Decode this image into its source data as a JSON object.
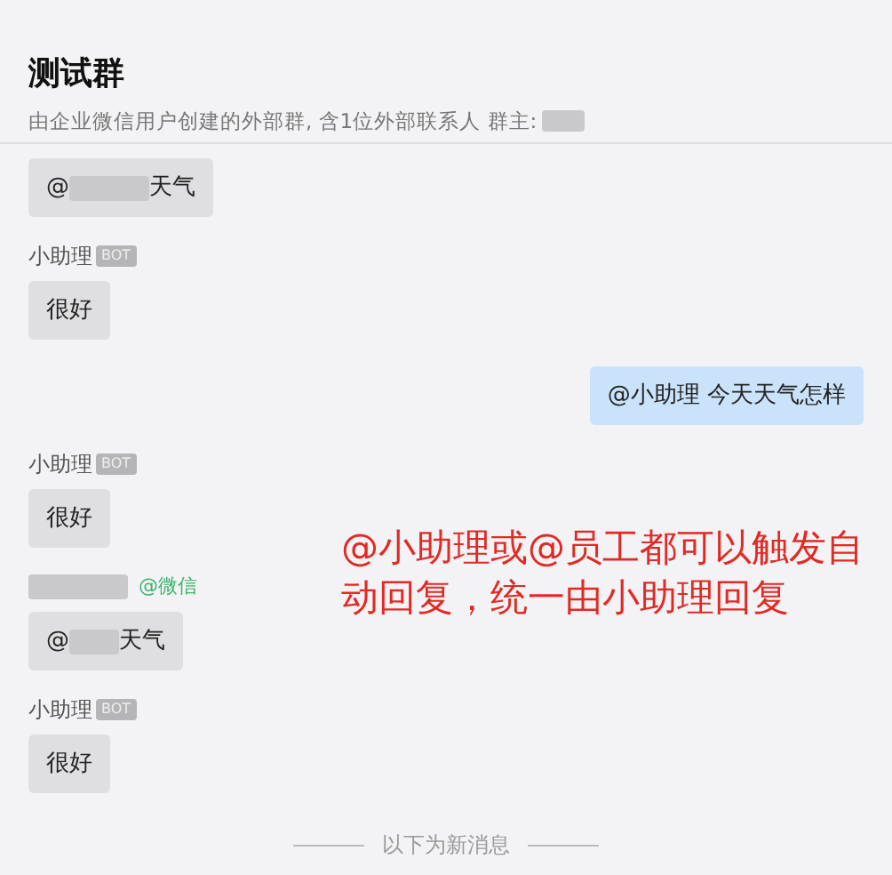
{
  "header": {
    "title": "测试群",
    "subtitle": "由企业微信用户创建的外部群, 含1位外部联系人 群主:",
    "subtitle_redacted": true
  },
  "messages": [
    {
      "kind": "incoming",
      "parts": [
        {
          "kind": "text",
          "text": "@"
        },
        {
          "kind": "redacted"
        },
        {
          "kind": "text",
          "text": "天气"
        }
      ]
    },
    {
      "kind": "incoming",
      "sender": {
        "name": "小助理",
        "badge": "BOT"
      },
      "parts": [
        {
          "kind": "text",
          "text": "很好"
        }
      ]
    },
    {
      "kind": "outgoing",
      "parts": [
        {
          "kind": "text",
          "text": "@小助理 今天天气怎样"
        }
      ]
    },
    {
      "kind": "incoming",
      "sender": {
        "name": "小助理",
        "badge": "BOT"
      },
      "parts": [
        {
          "kind": "text",
          "text": "很好"
        }
      ]
    },
    {
      "kind": "incoming",
      "sender": {
        "name_redacted": true,
        "tag": "@微信"
      },
      "parts": [
        {
          "kind": "text",
          "text": "@"
        },
        {
          "kind": "redacted"
        },
        {
          "kind": "text",
          "text": "天气"
        }
      ]
    },
    {
      "kind": "incoming",
      "sender": {
        "name": "小助理",
        "badge": "BOT"
      },
      "parts": [
        {
          "kind": "text",
          "text": "很好"
        }
      ]
    }
  ],
  "new_messages_divider": "以下为新消息",
  "annotation": "@小助理或@员工都可以触发自动回复，统一由小助理回复"
}
